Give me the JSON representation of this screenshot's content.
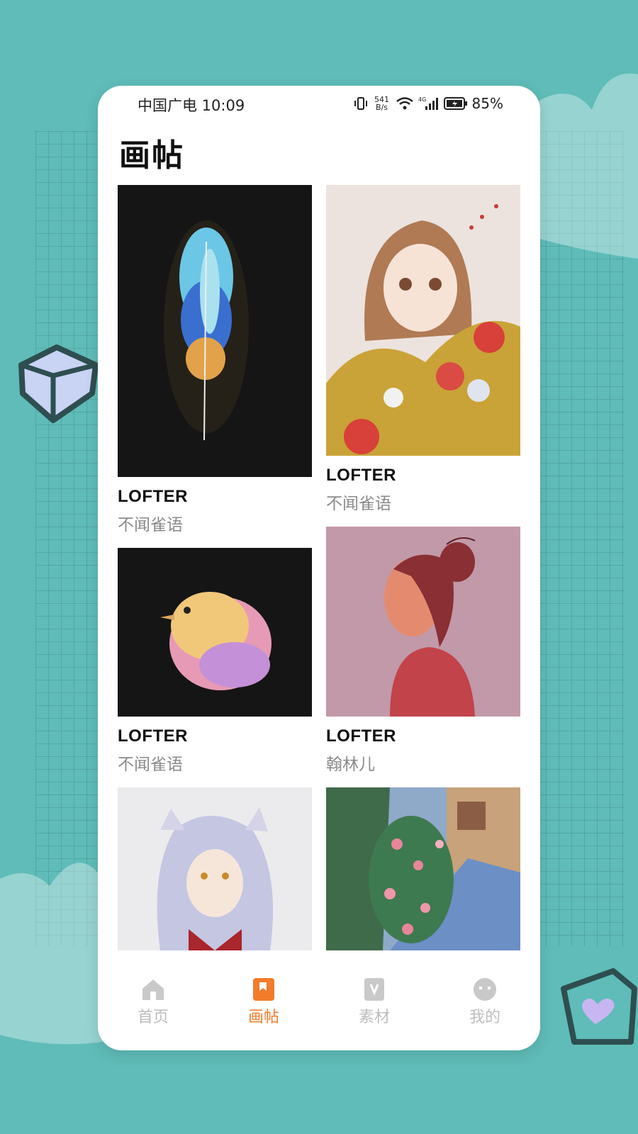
{
  "status_bar": {
    "carrier_time": "中国广电 10:09",
    "net_speed_value": "541",
    "net_speed_unit": "B/s",
    "network": "4G",
    "battery": "85%"
  },
  "page": {
    "title": "画帖"
  },
  "cards": [
    {
      "source": "LOFTER",
      "author": "不闻雀语",
      "art": "blue-feather-painting"
    },
    {
      "source": "LOFTER",
      "author": "不闻雀语",
      "art": "girl-with-flowers-painting"
    },
    {
      "source": "LOFTER",
      "author": "不闻雀语",
      "art": "pastel-chick-painting"
    },
    {
      "source": "LOFTER",
      "author": "翰林儿",
      "art": "red-haired-girl-profile-painting"
    },
    {
      "source": "",
      "author": "",
      "art": "white-haired-dog-boy-drawing"
    },
    {
      "source": "",
      "author": "",
      "art": "rose-garden-path-painting"
    }
  ],
  "tabbar": {
    "tabs": [
      {
        "label": "首页",
        "icon": "house-icon",
        "active": false
      },
      {
        "label": "画帖",
        "icon": "album-icon",
        "active": true
      },
      {
        "label": "素材",
        "icon": "material-icon",
        "active": false
      },
      {
        "label": "我的",
        "icon": "profile-face-icon",
        "active": false
      }
    ],
    "active_color": "#f27c2a",
    "inactive_color": "#bdbdbd"
  },
  "colors": {
    "background": "#5fbcb8",
    "card": "#ffffff",
    "accent": "#f27c2a"
  }
}
